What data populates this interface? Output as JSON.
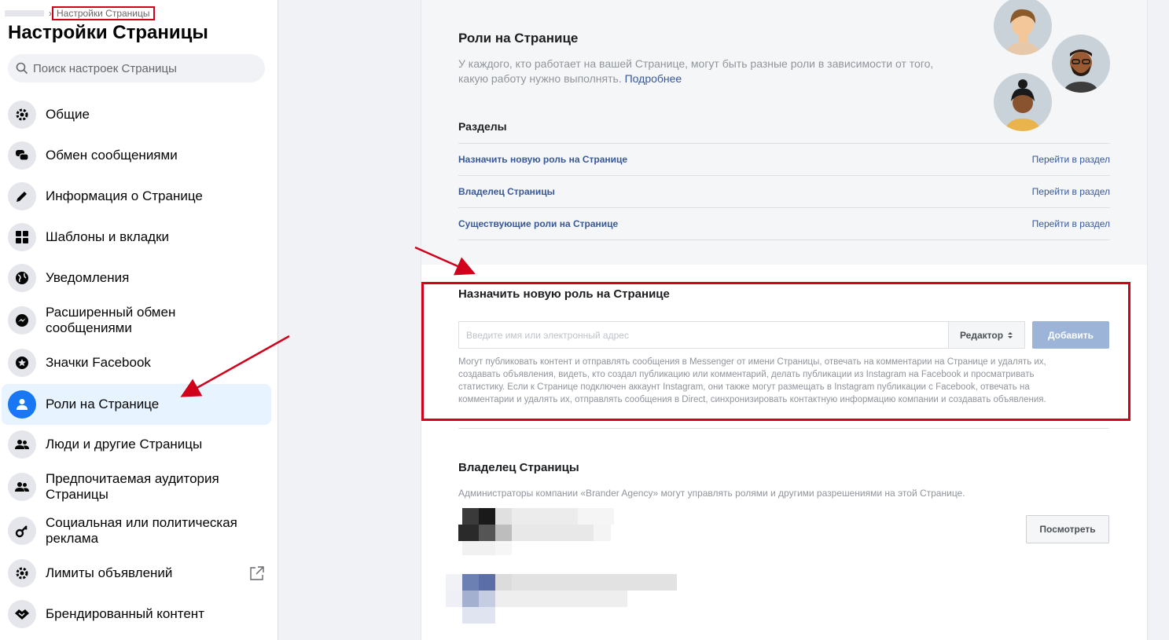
{
  "breadcrumb": {
    "current": "Настройки Страницы"
  },
  "sidebar": {
    "title": "Настройки Страницы",
    "search_placeholder": "Поиск настроек Страницы",
    "items": [
      {
        "label": "Общие",
        "icon": "gear-icon"
      },
      {
        "label": "Обмен сообщениями",
        "icon": "chat-icon"
      },
      {
        "label": "Информация о Странице",
        "icon": "pencil-icon"
      },
      {
        "label": "Шаблоны и вкладки",
        "icon": "grid-icon"
      },
      {
        "label": "Уведомления",
        "icon": "globe-icon"
      },
      {
        "label": "Расширенный обмен сообщениями",
        "icon": "messenger-icon"
      },
      {
        "label": "Значки Facebook",
        "icon": "star-badge-icon"
      },
      {
        "label": "Роли на Странице",
        "icon": "person-icon",
        "active": true
      },
      {
        "label": "Люди и другие Страницы",
        "icon": "people-icon"
      },
      {
        "label": "Предпочитаемая аудитория Страницы",
        "icon": "people-icon"
      },
      {
        "label": "Социальная или политическая реклама",
        "icon": "key-icon"
      },
      {
        "label": "Лимиты объявлений",
        "icon": "gear-icon",
        "external": true
      },
      {
        "label": "Брендированный контент",
        "icon": "handshake-icon"
      }
    ]
  },
  "roles": {
    "title": "Роли на Странице",
    "description": "У каждого, кто работает на вашей Странице, могут быть разные роли в зависимости от того, какую работу нужно выполнять.",
    "learn_more": "Подробнее",
    "sections_title": "Разделы",
    "sections": [
      {
        "label": "Назначить новую роль на Странице",
        "action": "Перейти в раздел"
      },
      {
        "label": "Владелец Страницы",
        "action": "Перейти в раздел"
      },
      {
        "label": "Существующие роли на Странице",
        "action": "Перейти в раздел"
      }
    ]
  },
  "assign": {
    "title": "Назначить новую роль на Странице",
    "input_placeholder": "Введите имя или электронный адрес",
    "role_selected": "Редактор",
    "add_label": "Добавить",
    "role_description": "Могут публиковать контент и отправлять сообщения в Messenger от имени Страницы, отвечать на комментарии на Странице и удалять их, создавать объявления, видеть, кто создал публикацию или комментарий, делать публикации из Instagram на Facebook и просматривать статистику. Если к Странице подключен аккаунт Instagram, они также могут размещать в Instagram публикации с Facebook, отвечать на комментарии и удалять их, отправлять сообщения в Direct, синхронизировать контактную информацию компании и создавать объявления."
  },
  "owner": {
    "title": "Владелец Страницы",
    "description": "Администраторы компании «Brander Agency» могут управлять ролями и другими разрешениями на этой Странице.",
    "view_label": "Посмотреть"
  },
  "colors": {
    "accent": "#1877f2",
    "link": "#385898",
    "annotation_red": "#d0021b"
  }
}
